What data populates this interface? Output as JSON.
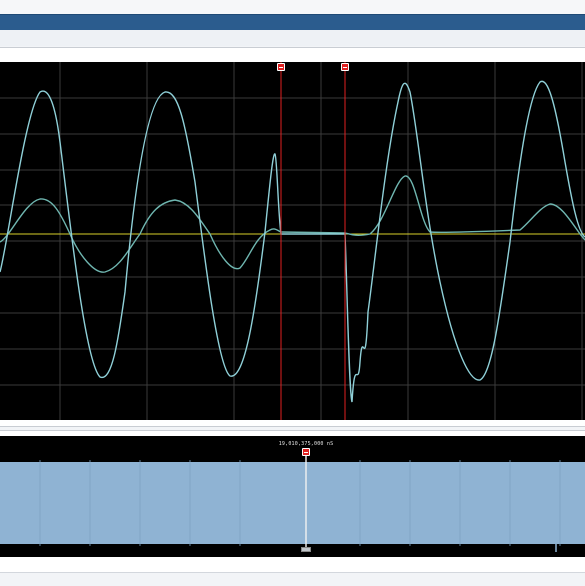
{
  "window": {
    "accent_color": "#2b5c8e"
  },
  "scope": {
    "trace_colors": {
      "current": "#8fd0d8",
      "voltage": "#6fb6b0",
      "baseline": "#d7d12a",
      "cursor": "#e02121",
      "grid": "#3a3a3a"
    },
    "markers": [
      {
        "id": "cursor-1",
        "label_icon": "flag-icon"
      },
      {
        "id": "cursor-2",
        "label_icon": "flag-icon"
      }
    ]
  },
  "overview": {
    "timestamp": "19,010,375,000 nS",
    "waveform_color": "#8fb3d3",
    "marker_icon": "flag-icon"
  }
}
